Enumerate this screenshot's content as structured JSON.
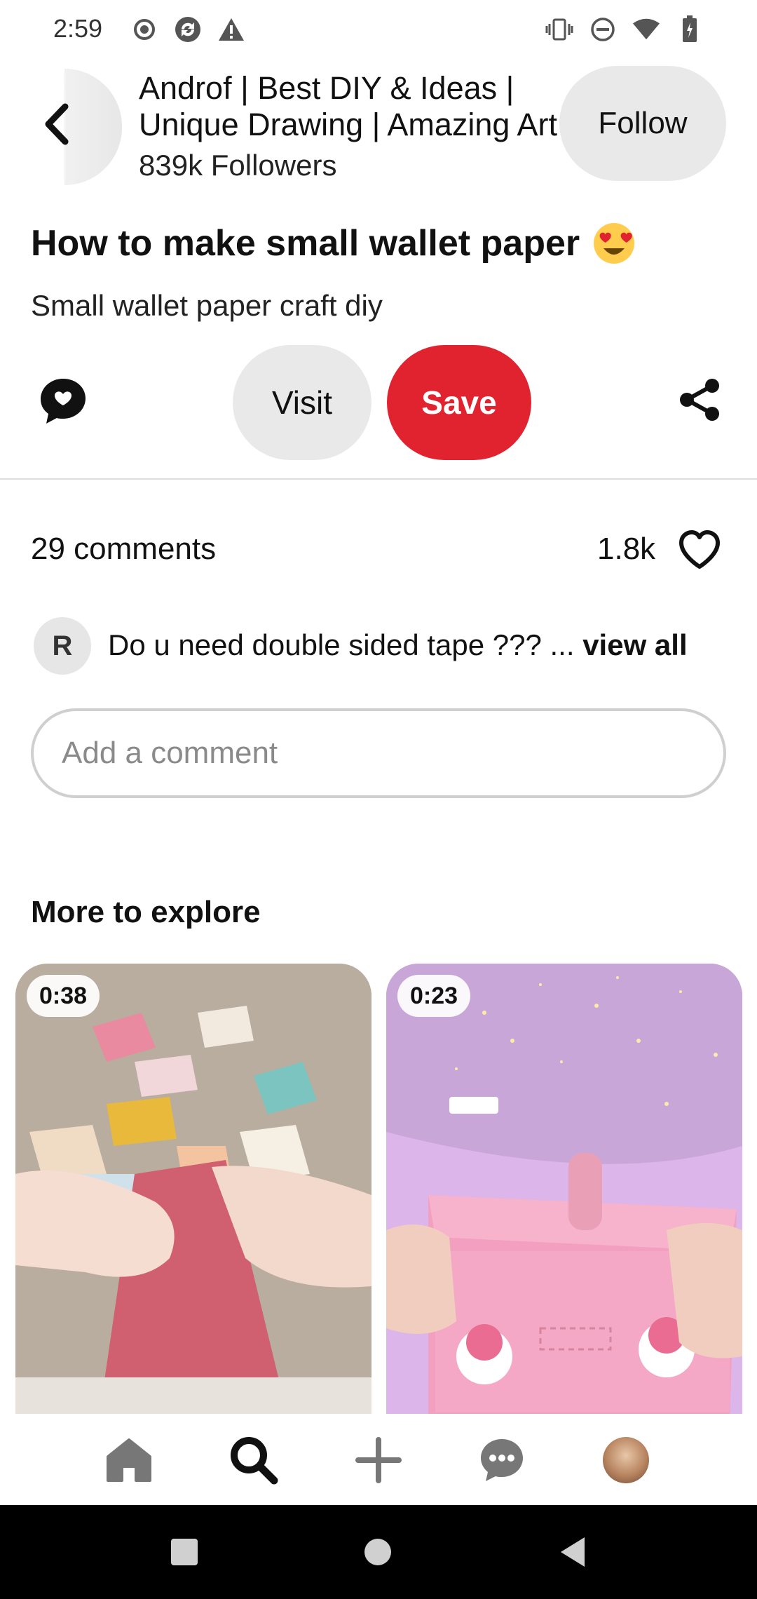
{
  "status_bar": {
    "time": "2:59",
    "left_icons": [
      "record-icon",
      "sync-icon",
      "warning-icon"
    ],
    "right_icons": [
      "vibrate-icon",
      "do-not-disturb-icon",
      "wifi-icon",
      "battery-icon"
    ]
  },
  "header": {
    "profile_name": "Androf | Best DIY & Ideas | Unique Drawing | Amazing Art",
    "followers": "839k Followers",
    "follow_label": "Follow"
  },
  "pin": {
    "title": "How to make small wallet paper",
    "description": "Small wallet paper craft diy"
  },
  "actions": {
    "visit_label": "Visit",
    "save_label": "Save"
  },
  "comments": {
    "count_label": "29 comments",
    "likes_label": "1.8k",
    "first_comment": {
      "avatar_initial": "R",
      "text": "Do u need double sided tape ??? ...",
      "view_all": "view all"
    },
    "input_placeholder": "Add a comment"
  },
  "explore": {
    "heading": "More to explore",
    "cards": [
      {
        "duration": "0:38"
      },
      {
        "duration": "0:23"
      }
    ]
  },
  "colors": {
    "save_red": "#e0232e",
    "pill_gray": "#e9e9e9"
  },
  "bottom_nav": [
    "home-icon",
    "search-icon",
    "create-icon",
    "messages-icon",
    "profile-avatar"
  ]
}
